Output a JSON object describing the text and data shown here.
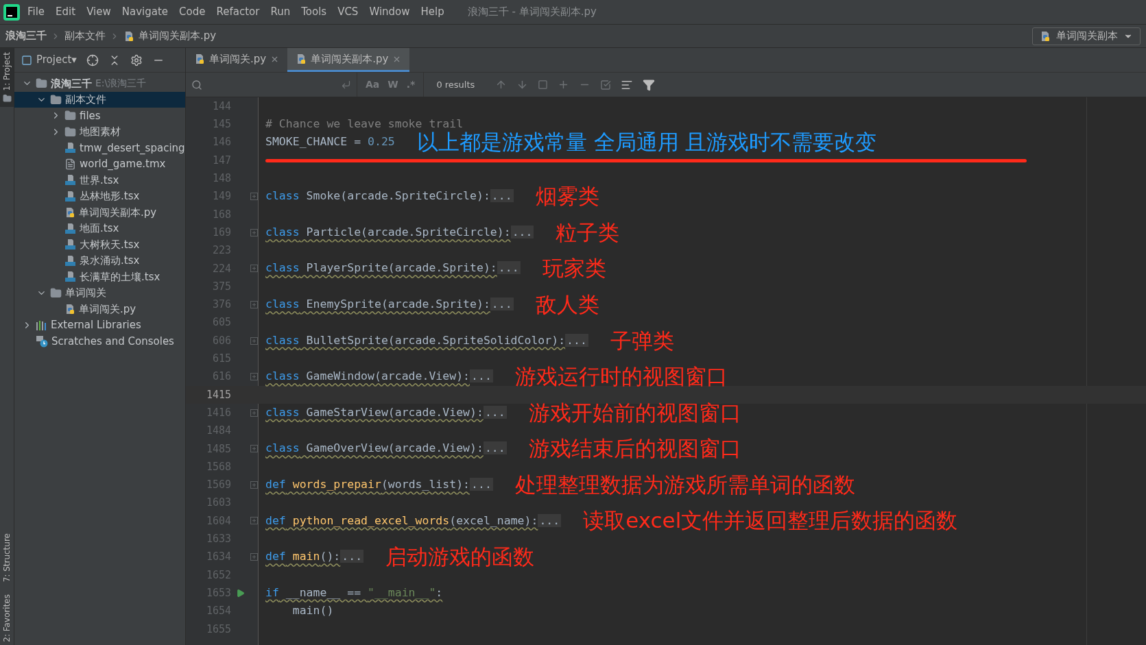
{
  "menu": {
    "items": [
      "File",
      "Edit",
      "View",
      "Navigate",
      "Code",
      "Refactor",
      "Run",
      "Tools",
      "VCS",
      "Window",
      "Help"
    ],
    "title": "浪淘三千 - 单词闯关副本.py"
  },
  "breadcrumb": {
    "items": [
      {
        "label": "浪淘三千",
        "kind": "project"
      },
      {
        "label": "副本文件",
        "kind": "folder"
      },
      {
        "label": "单词闯关副本.py",
        "kind": "py"
      }
    ],
    "run_config": "单词闯关副本"
  },
  "stripe": {
    "top": "1: Project",
    "bottom": [
      "7: Structure",
      "2: Favorites"
    ]
  },
  "project_panel": {
    "title": "Project▾",
    "tree": [
      {
        "label": "浪淘三千",
        "hint": "E:\\浪淘三千",
        "kind": "folder",
        "expanded": true,
        "selected": false,
        "children": [
          {
            "label": "副本文件",
            "kind": "folder",
            "expanded": true,
            "selected": true,
            "children": [
              {
                "label": "files",
                "kind": "folder",
                "expanded": false,
                "selected": false
              },
              {
                "label": "地图素材",
                "kind": "folder",
                "expanded": false,
                "selected": false
              },
              {
                "label": "tmw_desert_spacing",
                "kind": "tsx",
                "selected": false
              },
              {
                "label": "world_game.tmx",
                "kind": "file",
                "selected": false
              },
              {
                "label": "世界.tsx",
                "kind": "tsx",
                "selected": false
              },
              {
                "label": "丛林地形.tsx",
                "kind": "tsx",
                "selected": false
              },
              {
                "label": "单词闯关副本.py",
                "kind": "py",
                "selected": false
              },
              {
                "label": "地面.tsx",
                "kind": "tsx",
                "selected": false
              },
              {
                "label": "大树秋天.tsx",
                "kind": "tsx",
                "selected": false
              },
              {
                "label": "泉水涌动.tsx",
                "kind": "tsx",
                "selected": false
              },
              {
                "label": "长满草的土壤.tsx",
                "kind": "tsx",
                "selected": false
              }
            ]
          },
          {
            "label": "单词闯关",
            "kind": "folder",
            "expanded": true,
            "selected": false,
            "children": [
              {
                "label": "单词闯关.py",
                "kind": "py",
                "selected": false
              }
            ]
          }
        ]
      },
      {
        "label": "External Libraries",
        "kind": "libraries",
        "expanded": false,
        "selected": false
      },
      {
        "label": "Scratches and Consoles",
        "kind": "scratches",
        "selected": false
      }
    ]
  },
  "tabs": [
    {
      "label": "单词闯关.py",
      "selected": false
    },
    {
      "label": "单词闯关副本.py",
      "selected": true
    }
  ],
  "find_bar": {
    "options": [
      "Aa",
      "W",
      ".*"
    ],
    "results": "0 results"
  },
  "lines": [
    {
      "number": "144"
    },
    {
      "number": "145",
      "tokens": [
        {
          "text": "# Chance we leave smoke trail",
          "kind": "comment"
        }
      ]
    },
    {
      "number": "146",
      "tokens": [
        {
          "text": "SMOKE_CHANCE = ",
          "kind": "plain"
        },
        {
          "text": "0.25",
          "kind": "number"
        }
      ],
      "annotation": {
        "text": "以上都是游戏常量 全局通用 且游戏时不需要改变",
        "color": "#1e9bff"
      }
    },
    {
      "number": "147",
      "marked": true
    },
    {
      "number": "148"
    },
    {
      "number": "149",
      "folded": true,
      "warning": false,
      "tokens": [
        {
          "text": "class",
          "kind": "keyword"
        },
        {
          "text": " Smoke(arcade.SpriteCircle):",
          "kind": "plain"
        },
        {
          "text": "...",
          "kind": "fold"
        }
      ],
      "annotation": {
        "text": "烟雾类",
        "color": "#ff2a1a"
      }
    },
    {
      "number": "168"
    },
    {
      "number": "169",
      "folded": true,
      "warning": true,
      "tokens": [
        {
          "text": "class",
          "kind": "keyword"
        },
        {
          "text": " Particle(arcade.SpriteCircle):",
          "kind": "plain"
        },
        {
          "text": "...",
          "kind": "fold"
        }
      ],
      "annotation": {
        "text": "粒子类",
        "color": "#ff2a1a"
      }
    },
    {
      "number": "223"
    },
    {
      "number": "224",
      "folded": true,
      "warning": true,
      "tokens": [
        {
          "text": "class",
          "kind": "keyword"
        },
        {
          "text": " PlayerSprite(arcade.Sprite):",
          "kind": "plain"
        },
        {
          "text": "...",
          "kind": "fold"
        }
      ],
      "annotation": {
        "text": "玩家类",
        "color": "#ff2a1a"
      }
    },
    {
      "number": "375"
    },
    {
      "number": "376",
      "folded": true,
      "warning": true,
      "tokens": [
        {
          "text": "class",
          "kind": "keyword"
        },
        {
          "text": " EnemySprite(arcade.Sprite):",
          "kind": "plain"
        },
        {
          "text": "...",
          "kind": "fold"
        }
      ],
      "annotation": {
        "text": "敌人类",
        "color": "#ff2a1a"
      }
    },
    {
      "number": "605"
    },
    {
      "number": "606",
      "folded": true,
      "warning": true,
      "tokens": [
        {
          "text": "class",
          "kind": "keyword"
        },
        {
          "text": " BulletSprite(arcade.SpriteSolidColor):",
          "kind": "plain"
        },
        {
          "text": "...",
          "kind": "fold"
        }
      ],
      "annotation": {
        "text": "子弹类",
        "color": "#ff2a1a"
      }
    },
    {
      "number": "615"
    },
    {
      "number": "616",
      "folded": true,
      "warning": true,
      "tokens": [
        {
          "text": "class",
          "kind": "keyword"
        },
        {
          "text": " GameWindow(arcade.View):",
          "kind": "plain"
        },
        {
          "text": "...",
          "kind": "fold"
        }
      ],
      "annotation": {
        "text": "游戏运行时的视图窗口",
        "color": "#ff2a1a"
      }
    },
    {
      "number": "1415",
      "current": true
    },
    {
      "number": "1416",
      "folded": true,
      "warning": true,
      "tokens": [
        {
          "text": "class",
          "kind": "keyword"
        },
        {
          "text": " GameStarView(arcade.View):",
          "kind": "plain"
        },
        {
          "text": "...",
          "kind": "fold"
        }
      ],
      "annotation": {
        "text": "游戏开始前的视图窗口",
        "color": "#ff2a1a"
      }
    },
    {
      "number": "1484"
    },
    {
      "number": "1485",
      "folded": true,
      "warning": true,
      "tokens": [
        {
          "text": "class",
          "kind": "keyword"
        },
        {
          "text": " GameOverView(arcade.View):",
          "kind": "plain"
        },
        {
          "text": "...",
          "kind": "fold"
        }
      ],
      "annotation": {
        "text": "游戏结束后的视图窗口",
        "color": "#ff2a1a"
      }
    },
    {
      "number": "1568"
    },
    {
      "number": "1569",
      "folded": true,
      "warning": true,
      "tokens": [
        {
          "text": "def",
          "kind": "keyword"
        },
        {
          "text": " words_prepair",
          "kind": "function"
        },
        {
          "text": "(words_list):",
          "kind": "plain"
        },
        {
          "text": "...",
          "kind": "fold"
        }
      ],
      "annotation": {
        "text": "处理整理数据为游戏所需单词的函数",
        "color": "#ff2a1a"
      }
    },
    {
      "number": "1603"
    },
    {
      "number": "1604",
      "folded": true,
      "warning": true,
      "tokens": [
        {
          "text": "def",
          "kind": "keyword"
        },
        {
          "text": " python_read_excel_words",
          "kind": "function"
        },
        {
          "text": "(excel_name):",
          "kind": "plain"
        },
        {
          "text": "...",
          "kind": "fold"
        }
      ],
      "annotation": {
        "text": "读取excel文件并返回整理后数据的函数",
        "color": "#ff2a1a"
      }
    },
    {
      "number": "1633"
    },
    {
      "number": "1634",
      "folded": true,
      "warning": true,
      "tokens": [
        {
          "text": "def",
          "kind": "keyword"
        },
        {
          "text": " main",
          "kind": "function"
        },
        {
          "text": "():",
          "kind": "plain"
        },
        {
          "text": "...",
          "kind": "fold"
        }
      ],
      "annotation": {
        "text": "启动游戏的函数",
        "color": "#ff2a1a"
      }
    },
    {
      "number": "1652"
    },
    {
      "number": "1653",
      "run_marker": true,
      "warning": true,
      "tokens": [
        {
          "text": "if",
          "kind": "keyword"
        },
        {
          "text": " __name__ == ",
          "kind": "plain"
        },
        {
          "text": "\"__main__\"",
          "kind": "string"
        },
        {
          "text": ":",
          "kind": "plain"
        }
      ]
    },
    {
      "number": "1654",
      "tokens": [
        {
          "text": "    main()",
          "kind": "plain"
        }
      ]
    },
    {
      "number": "1655"
    }
  ]
}
